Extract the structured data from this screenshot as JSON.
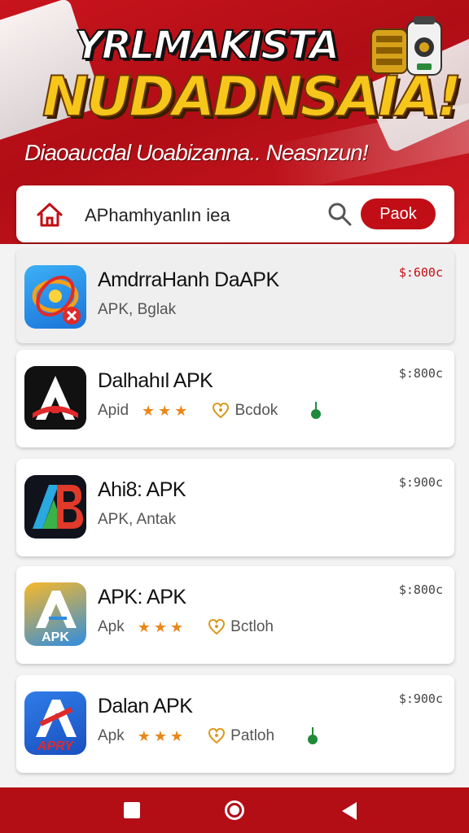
{
  "header": {
    "title_line1": "YRLMAKISTA",
    "title_line2": "NUDADNSAIA!",
    "subtitle": "Diaoaucdal Uoabizanna.. Neasnzun!"
  },
  "search": {
    "text": "APhamhyanlın iea",
    "button_label": "Paok"
  },
  "apps": [
    {
      "name": "AmdrraHanh DaAPK",
      "meta": "APK, Bglak",
      "price": "$:600c",
      "price_color": "#c10e16",
      "icon": "orbit-app-icon"
    },
    {
      "name": "Dalhahıl APK",
      "meta": "Apid",
      "stars": "★★★",
      "badge": "Bcdok",
      "price": "$:800c",
      "icon": "a-letter-app-icon"
    },
    {
      "name": "Ahi8: APK",
      "meta": "APK, Antak",
      "price": "$:900c",
      "icon": "ab-letter-app-icon"
    },
    {
      "name": "APK: APK",
      "meta": "Apk",
      "stars": "★★★",
      "badge": "Bctloh",
      "price": "$:800c",
      "icon": "apk-app-icon"
    },
    {
      "name": "Dalan APK",
      "meta": "Apk",
      "stars": "★★★",
      "badge": "Patloh",
      "price": "$:900c",
      "icon": "apry-app-icon"
    }
  ],
  "colors": {
    "brand_red": "#c10e16",
    "gold": "#f7c61b",
    "star": "#e8871a",
    "leaf": "#1f8a3a"
  }
}
